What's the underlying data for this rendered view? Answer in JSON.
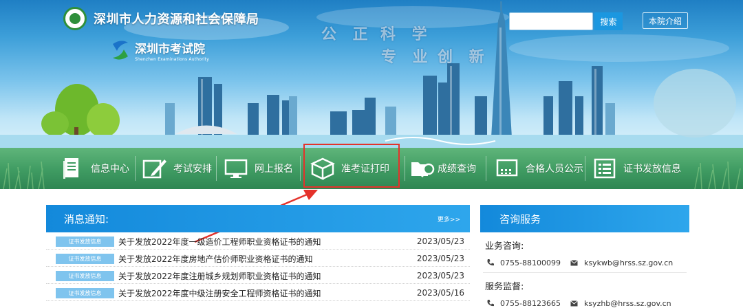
{
  "header": {
    "org_name": "深圳市人力资源和社会保障局",
    "sub_org_cn": "深圳市考试院",
    "sub_org_en": "Shenzhen Examinations Authority",
    "slogans": [
      "公 正",
      "科 学",
      "专 业",
      "创 新"
    ],
    "search": {
      "placeholder": "",
      "button_label": "搜索"
    },
    "intro_label": "本院介绍"
  },
  "nav": {
    "items": [
      {
        "label": "信息中心",
        "icon": "document-icon"
      },
      {
        "label": "考试安排",
        "icon": "pen-icon"
      },
      {
        "label": "网上报名",
        "icon": "monitor-icon"
      },
      {
        "label": "准考证打印",
        "icon": "box-icon",
        "highlighted": true
      },
      {
        "label": "成绩查询",
        "icon": "folder-search-icon"
      },
      {
        "label": "合格人员公示",
        "icon": "calendar-icon"
      },
      {
        "label": "证书发放信息",
        "icon": "list-icon"
      }
    ]
  },
  "notices": {
    "title": "消息通知:",
    "more_label": "更多>>",
    "rows": [
      {
        "tag": "证书发放信息",
        "title": "关于发放2022年度一级造价工程师职业资格证书的通知",
        "date": "2023/05/23"
      },
      {
        "tag": "证书发放信息",
        "title": "关于发放2022年度房地产估价师职业资格证书的通知",
        "date": "2023/05/23"
      },
      {
        "tag": "证书发放信息",
        "title": "关于发放2022年度注册城乡规划师职业资格证书的通知",
        "date": "2023/05/23"
      },
      {
        "tag": "证书发放信息",
        "title": "关于发放2022年度中级注册安全工程师资格证书的通知",
        "date": "2023/05/16"
      }
    ]
  },
  "consult": {
    "title": "咨询服务",
    "business_label": "业务咨询:",
    "business_phone": "0755-88100099",
    "business_email": "ksykwb@hrss.sz.gov.cn",
    "supervision_label": "服务监督:",
    "supervision_phone": "0755-88123665",
    "supervision_email": "ksyzhb@hrss.sz.gov.cn"
  },
  "colors": {
    "accent_blue": "#1b97e0",
    "nav_green": "#3f9b62",
    "highlight_red": "#e4322b",
    "tag_blue": "#7fc4ee"
  }
}
